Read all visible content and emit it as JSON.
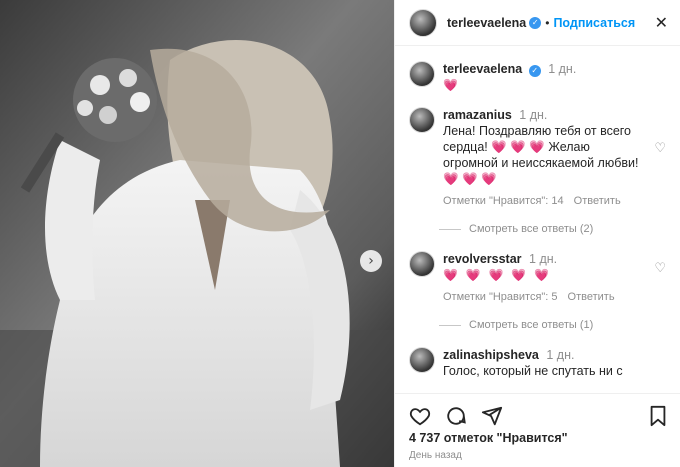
{
  "header": {
    "username": "terleevaelena",
    "separator": "•",
    "follow_label": "Подписаться",
    "close_glyph": "✕"
  },
  "caption": {
    "username": "terleevaelena",
    "time": "1 дн.",
    "text": "💗"
  },
  "comments": [
    {
      "username": "ramazanius",
      "time": "1 дн.",
      "text": "Лена! Поздравляю тебя от всего сердца! 💗 💗 💗 Желаю огромной и неиссякаемой любви! 💗 💗 💗",
      "likes_label": "Отметки \"Нравится\": 14",
      "reply_label": "Ответить",
      "view_replies": "Смотреть все ответы (2)"
    },
    {
      "username": "revolversstar",
      "time": "1 дн.",
      "text": "💗 💗 💗 💗 💗",
      "likes_label": "Отметки \"Нравится\": 5",
      "reply_label": "Ответить",
      "view_replies": "Смотреть все ответы (1)"
    },
    {
      "username": "zalinashipsheva",
      "time": "1 дн.",
      "text": "Голос, который не спутать ни с"
    }
  ],
  "footer": {
    "likes_count": "4 737 отметок \"Нравится\"",
    "date": "День назад"
  },
  "colors": {
    "accent": "#0095f6",
    "heart": "#ed4956",
    "muted": "#8e8e8e"
  }
}
